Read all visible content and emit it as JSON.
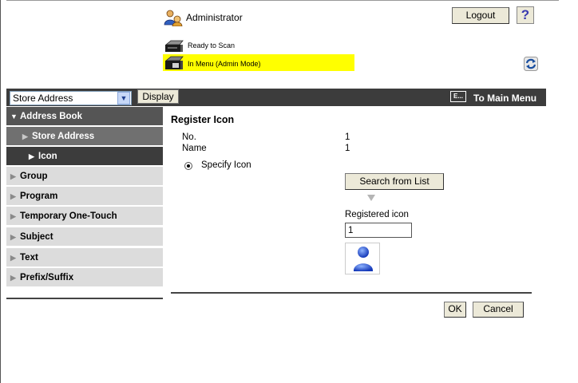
{
  "header": {
    "user_label": "Administrator",
    "logout_label": "Logout",
    "help_label": "?",
    "status_scan": "Ready to Scan",
    "status_menu": "In Menu (Admin Mode)"
  },
  "toolbar": {
    "select_value": "Store Address",
    "display_label": "Display",
    "main_menu_icon_text": "E...",
    "main_menu_label": "To Main Menu"
  },
  "sidebar": {
    "items": [
      {
        "label": "Address Book",
        "level": "head",
        "expanded": true
      },
      {
        "label": "Store Address",
        "level": "sub1"
      },
      {
        "label": "Icon",
        "level": "sub2",
        "selected": true
      },
      {
        "label": "Group",
        "level": "top"
      },
      {
        "label": "Program",
        "level": "top"
      },
      {
        "label": "Temporary One-Touch",
        "level": "top"
      },
      {
        "label": "Subject",
        "level": "top"
      },
      {
        "label": "Text",
        "level": "top"
      },
      {
        "label": "Prefix/Suffix",
        "level": "top"
      }
    ]
  },
  "main": {
    "title": "Register Icon",
    "no_label": "No.",
    "no_value": "1",
    "name_label": "Name",
    "name_value": "1",
    "radio_label": "Specify Icon",
    "radio_selected": true,
    "search_label": "Search from List",
    "registered_label": "Registered icon",
    "registered_value": "1",
    "preview_icon": "person-icon",
    "ok_label": "OK",
    "cancel_label": "Cancel"
  },
  "colors": {
    "status_highlight": "#ffff00",
    "dark_bar": "#3c3c3c",
    "sidebar_gray": "#dcdcdc",
    "sidebar_selected": "#3c3c3c"
  }
}
